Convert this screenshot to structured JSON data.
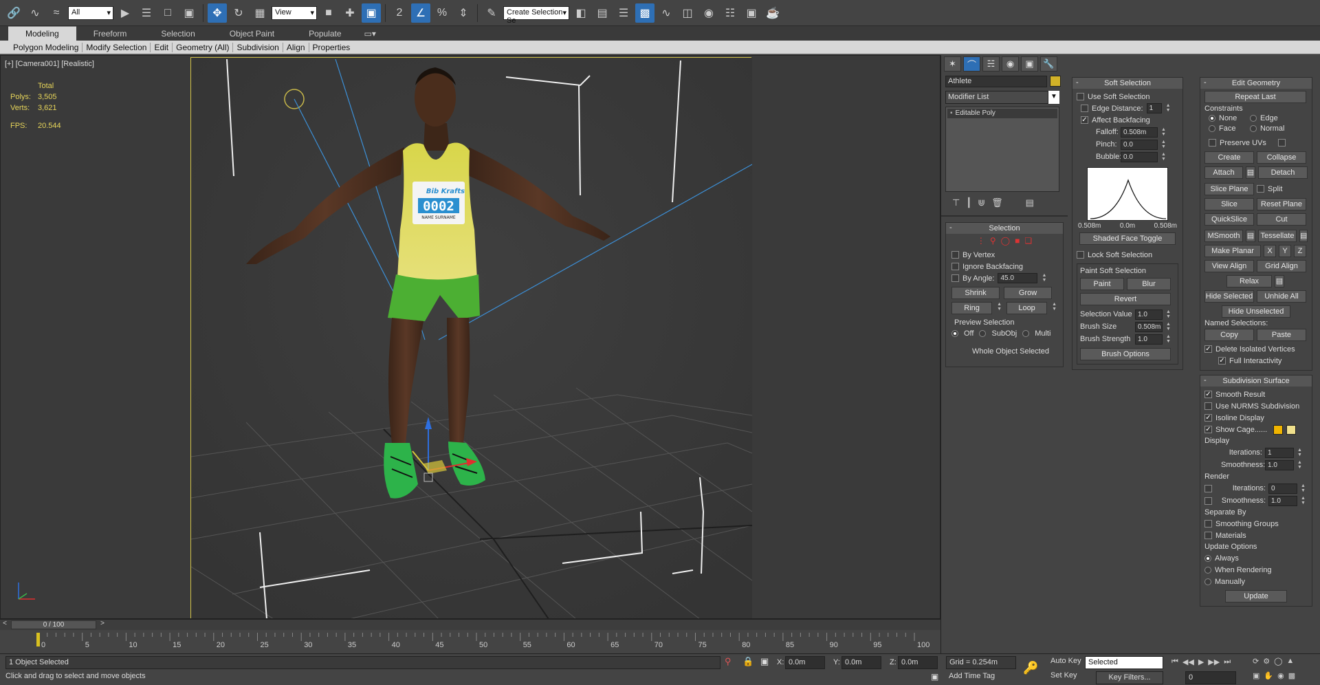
{
  "toolbar": {
    "selection_filter": "All",
    "ref_coord": "View",
    "named_selection": "Create Selection Se",
    "snap_label": "2",
    "angle_snap": "%"
  },
  "ribbon": {
    "tabs": [
      "Modeling",
      "Freeform",
      "Selection",
      "Object Paint",
      "Populate"
    ],
    "sub_items": [
      "Polygon Modeling",
      "Modify Selection",
      "Edit",
      "Geometry (All)",
      "Subdivision",
      "Align",
      "Properties"
    ]
  },
  "viewport": {
    "label": "[+] [Camera001] [Realistic]",
    "stats": {
      "total_label": "Total",
      "polys_label": "Polys:",
      "polys_value": "3,505",
      "verts_label": "Verts:",
      "verts_value": "3,621",
      "fps_label": "FPS:",
      "fps_value": "20.544"
    },
    "bib_number": "0002",
    "bib_name": "NAME SURNAME",
    "bib_brand": "Bib Krafts"
  },
  "command_panel": {
    "object_name": "Athlete",
    "modifier_list": "Modifier List",
    "stack_item": "Editable Poly",
    "selection": {
      "title": "Selection",
      "by_vertex": "By Vertex",
      "ignore_backfacing": "Ignore Backfacing",
      "by_angle": "By Angle:",
      "by_angle_value": "45.0",
      "shrink": "Shrink",
      "grow": "Grow",
      "ring": "Ring",
      "loop": "Loop",
      "preview_title": "Preview Selection",
      "preview_off": "Off",
      "preview_subobj": "SubObj",
      "preview_multi": "Multi",
      "status": "Whole Object Selected"
    },
    "soft_selection": {
      "title": "Soft Selection",
      "use_soft": "Use Soft Selection",
      "edge_distance": "Edge Distance:",
      "edge_distance_value": "1",
      "affect_backfacing": "Affect Backfacing",
      "falloff": "Falloff:",
      "falloff_value": "0.508m",
      "pinch": "Pinch:",
      "pinch_value": "0.0",
      "bubble": "Bubble:",
      "bubble_value": "0.0",
      "curve_left": "0.508m",
      "curve_mid": "0.0m",
      "curve_right": "0.508m",
      "shaded_face_toggle": "Shaded Face Toggle",
      "lock_soft": "Lock Soft Selection",
      "paint_title": "Paint Soft Selection",
      "paint": "Paint",
      "blur": "Blur",
      "revert": "Revert",
      "selection_value": "Selection Value",
      "selection_value_v": "1.0",
      "brush_size": "Brush Size",
      "brush_size_v": "0.508m",
      "brush_strength": "Brush Strength",
      "brush_strength_v": "1.0",
      "brush_options": "Brush Options"
    },
    "edit_geometry": {
      "title": "Edit Geometry",
      "repeat_last": "Repeat Last",
      "constraints": "Constraints",
      "none": "None",
      "edge": "Edge",
      "face": "Face",
      "normal": "Normal",
      "preserve_uvs": "Preserve UVs",
      "create": "Create",
      "collapse": "Collapse",
      "attach": "Attach",
      "detach": "Detach",
      "slice_plane": "Slice Plane",
      "split": "Split",
      "slice": "Slice",
      "reset_plane": "Reset Plane",
      "quickslice": "QuickSlice",
      "cut": "Cut",
      "msmooth": "MSmooth",
      "tessellate": "Tessellate",
      "make_planar": "Make Planar",
      "x": "X",
      "y": "Y",
      "z": "Z",
      "view_align": "View Align",
      "grid_align": "Grid Align",
      "relax": "Relax",
      "hide_selected": "Hide Selected",
      "unhide_all": "Unhide All",
      "hide_unselected": "Hide Unselected",
      "named_selections": "Named Selections:",
      "copy": "Copy",
      "paste": "Paste",
      "delete_isolated": "Delete Isolated Vertices",
      "full_interactivity": "Full Interactivity"
    },
    "subdivision": {
      "title": "Subdivision Surface",
      "smooth_result": "Smooth Result",
      "use_nurms": "Use NURMS Subdivision",
      "isoline": "Isoline Display",
      "show_cage": "Show Cage......",
      "display": "Display",
      "iterations": "Iterations:",
      "iterations_v": "1",
      "smoothness": "Smoothness:",
      "smoothness_v": "1.0",
      "render": "Render",
      "r_iterations_v": "0",
      "r_smoothness_v": "1.0",
      "separate_by": "Separate By",
      "smoothing_groups": "Smoothing Groups",
      "materials": "Materials",
      "update_options": "Update Options",
      "always": "Always",
      "when_rendering": "When Rendering",
      "manually": "Manually",
      "update": "Update"
    }
  },
  "timeline": {
    "frame": "0 / 100",
    "ticks": [
      "0",
      "5",
      "10",
      "15",
      "20",
      "25",
      "30",
      "35",
      "40",
      "45",
      "50",
      "55",
      "60",
      "65",
      "70",
      "75",
      "80",
      "85",
      "90",
      "95",
      "100"
    ]
  },
  "status": {
    "selected": "1 Object Selected",
    "prompt": "Click and drag to select and move objects",
    "x_label": "X:",
    "x_value": "0.0m",
    "y_label": "Y:",
    "y_value": "0.0m",
    "z_label": "Z:",
    "z_value": "0.0m",
    "grid": "Grid = 0.254m",
    "add_time_tag": "Add Time Tag",
    "auto_key": "Auto Key",
    "set_key": "Set Key",
    "key_mode": "Selected",
    "key_filters": "Key Filters...",
    "current_frame": "0"
  }
}
